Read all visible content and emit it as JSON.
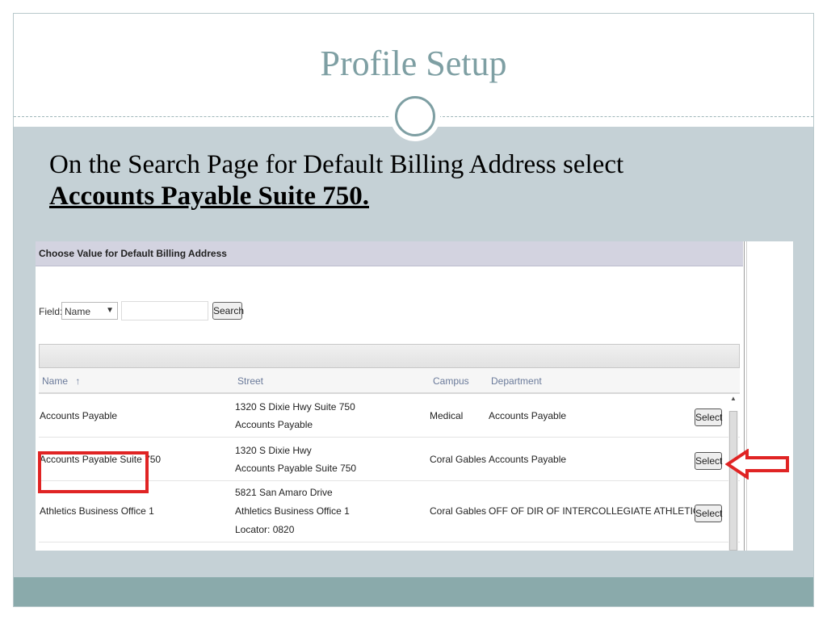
{
  "slide": {
    "title": "Profile Setup",
    "instruction_text": "On the Search Page for Default Billing Address select",
    "instruction_emphasis": "Accounts Payable Suite 750."
  },
  "search_page": {
    "header": "Choose Value for Default Billing Address",
    "field_label": "Field:",
    "field_value": "Name",
    "search_value": "",
    "search_button": "Search",
    "sort_indicator": "↑",
    "columns": {
      "name": "Name",
      "street": "Street",
      "campus": "Campus",
      "department": "Department"
    },
    "rows": [
      {
        "name": "Accounts Payable",
        "street_line1": "1320 S Dixie Hwy Suite 750",
        "street_line2": "Accounts Payable",
        "street_line3": "",
        "campus": "Medical",
        "department": "Accounts Payable",
        "action": "Select"
      },
      {
        "name": "Accounts Payable Suite 750",
        "street_line1": "1320 S Dixie Hwy",
        "street_line2": "Accounts Payable Suite 750",
        "street_line3": "",
        "campus": "Coral Gables",
        "department": "Accounts Payable",
        "action": "Select"
      },
      {
        "name": "Athletics Business Office 1",
        "street_line1": "5821 San Amaro Drive",
        "street_line2": "Athletics Business Office 1",
        "street_line3": "Locator: 0820",
        "campus": "Coral Gables",
        "department": "OFF OF DIR OF INTERCOLLEGIATE ATHLETICS",
        "action": "Select"
      }
    ]
  },
  "icons": {
    "dropdown": "chevron-down-icon",
    "scroll_up": "scroll-up-icon",
    "arrow": "left-arrow-icon",
    "divider_circle": "circle-ornament-icon"
  },
  "colors": {
    "title": "#7e9fa3",
    "body_band": "#c5d1d6",
    "footer_band": "#8aaaab",
    "highlight": "#e02424"
  }
}
